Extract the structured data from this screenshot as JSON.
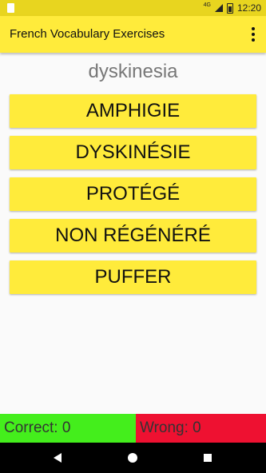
{
  "status_bar": {
    "time": "12:20",
    "network": "4G",
    "icons": [
      "sd-card-icon",
      "signal-icon",
      "battery-icon"
    ]
  },
  "app_bar": {
    "title": "French Vocabulary Exercises",
    "menu_icon": "overflow-menu-icon"
  },
  "quiz": {
    "word": "dyskinesia",
    "choices": [
      "AMPHIGIE",
      "DYSKINÉSIE",
      "PROTÉGÉ",
      "NON RÉGÉNÉRÉ",
      "PUFFER"
    ]
  },
  "score": {
    "correct": "Correct: 0",
    "wrong": "Wrong: 0"
  },
  "colors": {
    "status_bar": "#e8d51f",
    "app_bar": "#ffeb3b",
    "choice": "#ffeb3b",
    "correct": "#44ee1c",
    "wrong": "#ee1131"
  },
  "nav_bar": {
    "icons": [
      "back-icon",
      "home-icon",
      "recents-icon"
    ]
  }
}
